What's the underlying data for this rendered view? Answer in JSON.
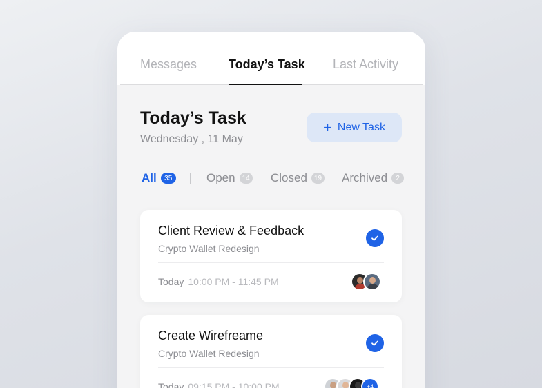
{
  "tabs": [
    {
      "label": "Messages"
    },
    {
      "label": "Today’s Task"
    },
    {
      "label": "Last Activity"
    }
  ],
  "header": {
    "title": "Today’s Task",
    "date": "Wednesday , 11 May",
    "new_task_label": "New Task"
  },
  "filters": [
    {
      "label": "All",
      "count": "35"
    },
    {
      "label": "Open",
      "count": "14"
    },
    {
      "label": "Closed",
      "count": "19"
    },
    {
      "label": "Archived",
      "count": "2"
    }
  ],
  "tasks": [
    {
      "title": "Client Review & Feedback",
      "project": "Crypto Wallet Redesign",
      "day": "Today",
      "time": "10:00 PM - 11:45 PM",
      "done": true
    },
    {
      "title": "Create Wirefreame",
      "project": "Crypto Wallet Redesign",
      "day": "Today",
      "time": "09:15 PM - 10:00 PM",
      "done": true,
      "more_label": "+4"
    }
  ],
  "colors": {
    "accent": "#1f63e6",
    "accent_soft": "#dde7f7",
    "text": "#121212",
    "muted": "#8c8d92"
  },
  "icons": {
    "new_task": "plus-icon",
    "done": "check-icon"
  }
}
